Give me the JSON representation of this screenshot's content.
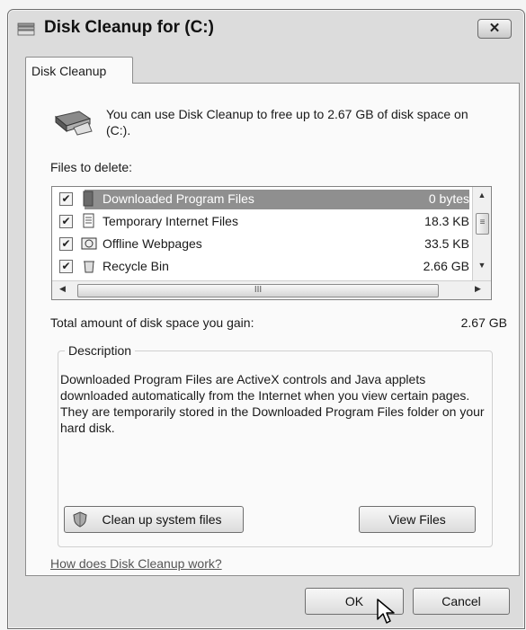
{
  "window": {
    "title": "Disk Cleanup for  (C:)",
    "close_label": "✕",
    "icons": [
      "drive-icon",
      "close-icon"
    ]
  },
  "tab": {
    "label": "Disk Cleanup"
  },
  "intro": {
    "text": "You can use Disk Cleanup to free up to 2.67 GB of disk space on  (C:)."
  },
  "files": {
    "label": "Files to delete:",
    "items": [
      {
        "name": "Downloaded Program Files",
        "size": "0 bytes",
        "checked": true,
        "selected": true,
        "icon": "folder-icon"
      },
      {
        "name": "Temporary Internet Files",
        "size": "18.3 KB",
        "checked": true,
        "selected": false,
        "icon": "document-icon"
      },
      {
        "name": "Offline Webpages",
        "size": "33.5 KB",
        "checked": true,
        "selected": false,
        "icon": "webpage-icon"
      },
      {
        "name": "Recycle Bin",
        "size": "2.66 GB",
        "checked": true,
        "selected": false,
        "icon": "recycle-bin-icon"
      }
    ],
    "scroll_glyphs": {
      "up": "▲",
      "down": "▼",
      "left": "◀",
      "right": "▶",
      "v_grip": "≡",
      "h_grip": "III"
    }
  },
  "total": {
    "label": "Total amount of disk space you gain:",
    "value": "2.67 GB"
  },
  "description": {
    "title": "Description",
    "text": "Downloaded Program Files are ActiveX controls and Java applets downloaded automatically from the Internet when you view certain pages. They are temporarily stored in the Downloaded Program Files folder on your hard disk."
  },
  "buttons": {
    "clean_system": "Clean up system files",
    "view_files": "View Files",
    "ok": "OK",
    "cancel": "Cancel"
  },
  "help_link": "How does Disk Cleanup work?",
  "colors": {
    "selected_row": "#8f8f8f",
    "window_frame": "#dcdcdc",
    "panel": "#fafafa"
  }
}
